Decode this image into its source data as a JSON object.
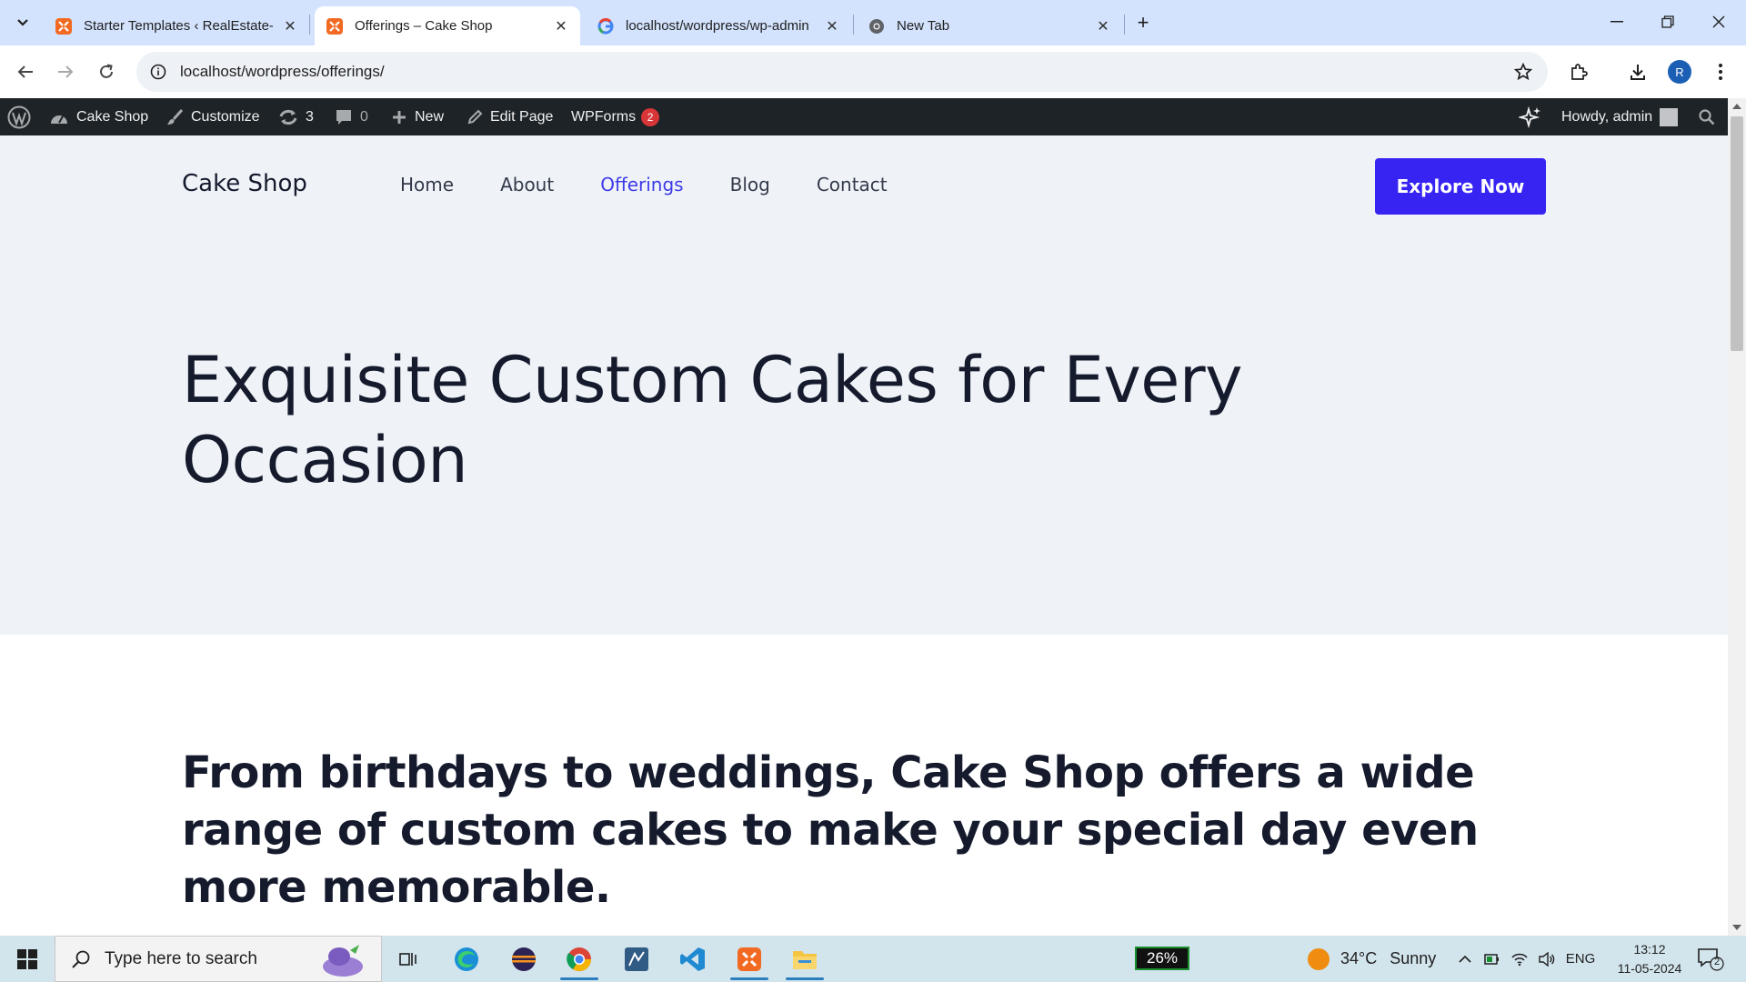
{
  "browser": {
    "tabs": [
      {
        "title": "Starter Templates ‹ RealEstate-E",
        "favicon": "xampp-icon",
        "active": false
      },
      {
        "title": "Offerings – Cake Shop",
        "favicon": "xampp-icon",
        "active": true
      },
      {
        "title": "localhost/wordpress/wp-admin",
        "favicon": "google-icon",
        "active": false
      },
      {
        "title": "New Tab",
        "favicon": "chrome-icon",
        "active": false
      }
    ],
    "url": "localhost/wordpress/offerings/",
    "profile_initial": "R"
  },
  "adminbar": {
    "site_name": "Cake Shop",
    "customize": "Customize",
    "updates_count": "3",
    "comments_count": "0",
    "new_label": "New",
    "edit_page": "Edit Page",
    "wpforms": "WPForms",
    "wpforms_count": "2",
    "greeting": "Howdy, admin"
  },
  "site": {
    "title": "Cake Shop",
    "menu": [
      "Home",
      "About",
      "Offerings",
      "Blog",
      "Contact"
    ],
    "current_menu": "Offerings",
    "cta": "Explore Now",
    "hero_heading": "Exquisite Custom Cakes for Every Occasion",
    "intro": "From birthdays to weddings, Cake Shop offers a wide range of custom cakes to make your special day even more memorable.",
    "accent_color": "#3724f3"
  },
  "taskbar": {
    "search_placeholder": "Type here to search",
    "battery": "26%",
    "weather_temp": "34°C",
    "weather_desc": "Sunny",
    "language": "ENG",
    "time": "13:12",
    "date": "11-05-2024",
    "notification_count": "2"
  }
}
